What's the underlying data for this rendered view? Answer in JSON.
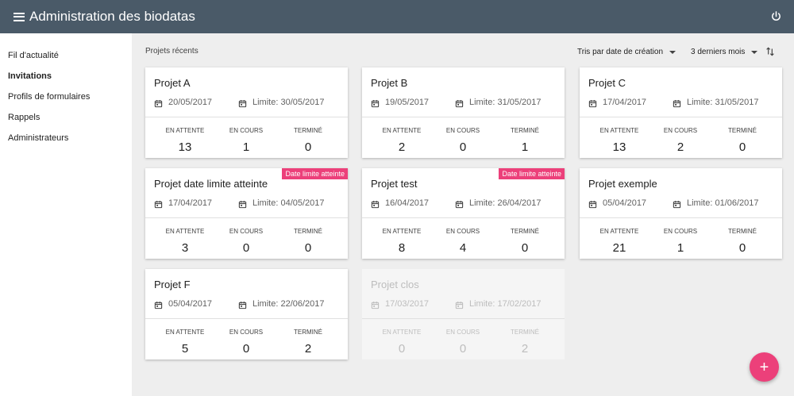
{
  "header": {
    "title": "Administration des biodatas"
  },
  "sidebar": {
    "items": [
      {
        "label": "Fil d'actualité"
      },
      {
        "label": "Invitations"
      },
      {
        "label": "Profils de formulaires"
      },
      {
        "label": "Rappels"
      },
      {
        "label": "Administrateurs"
      }
    ]
  },
  "main": {
    "section_title": "Projets récents",
    "sort_label": "Tris par date de création",
    "period_label": "3 derniers mois"
  },
  "stat_labels": {
    "pending": "EN ATTENTE",
    "in_progress": "EN COURS",
    "done": "TERMINÉ"
  },
  "projects": [
    {
      "name": "Projet A",
      "date": "20/05/2017",
      "limit": "Limite: 30/05/2017",
      "pending": "13",
      "in_progress": "1",
      "done": "0"
    },
    {
      "name": "Projet B",
      "date": "19/05/2017",
      "limit": "Limite: 31/05/2017",
      "pending": "2",
      "in_progress": "0",
      "done": "1"
    },
    {
      "name": "Projet C",
      "date": "17/04/2017",
      "limit": "Limite: 31/05/2017",
      "pending": "13",
      "in_progress": "2",
      "done": "0"
    },
    {
      "name": "Projet date limite atteinte",
      "date": "17/04/2017",
      "limit": "Limite: 04/05/2017",
      "pending": "3",
      "in_progress": "0",
      "done": "0",
      "badge": "Date limite atteinte"
    },
    {
      "name": "Projet test",
      "date": "16/04/2017",
      "limit": "Limite: 26/04/2017",
      "pending": "8",
      "in_progress": "4",
      "done": "0",
      "badge": "Date limite atteinte"
    },
    {
      "name": "Projet exemple",
      "date": "05/04/2017",
      "limit": "Limite: 01/06/2017",
      "pending": "21",
      "in_progress": "1",
      "done": "0"
    },
    {
      "name": "Projet F",
      "date": "05/04/2017",
      "limit": "Limite: 22/06/2017",
      "pending": "5",
      "in_progress": "0",
      "done": "2"
    },
    {
      "name": "Projet clos",
      "date": "17/03/2017",
      "limit": "Limite: 17/02/2017",
      "pending": "0",
      "in_progress": "0",
      "done": "2"
    }
  ],
  "fab": {
    "label": "+"
  },
  "colors": {
    "topbar": "#4a5a68",
    "accent": "#ec407a"
  }
}
